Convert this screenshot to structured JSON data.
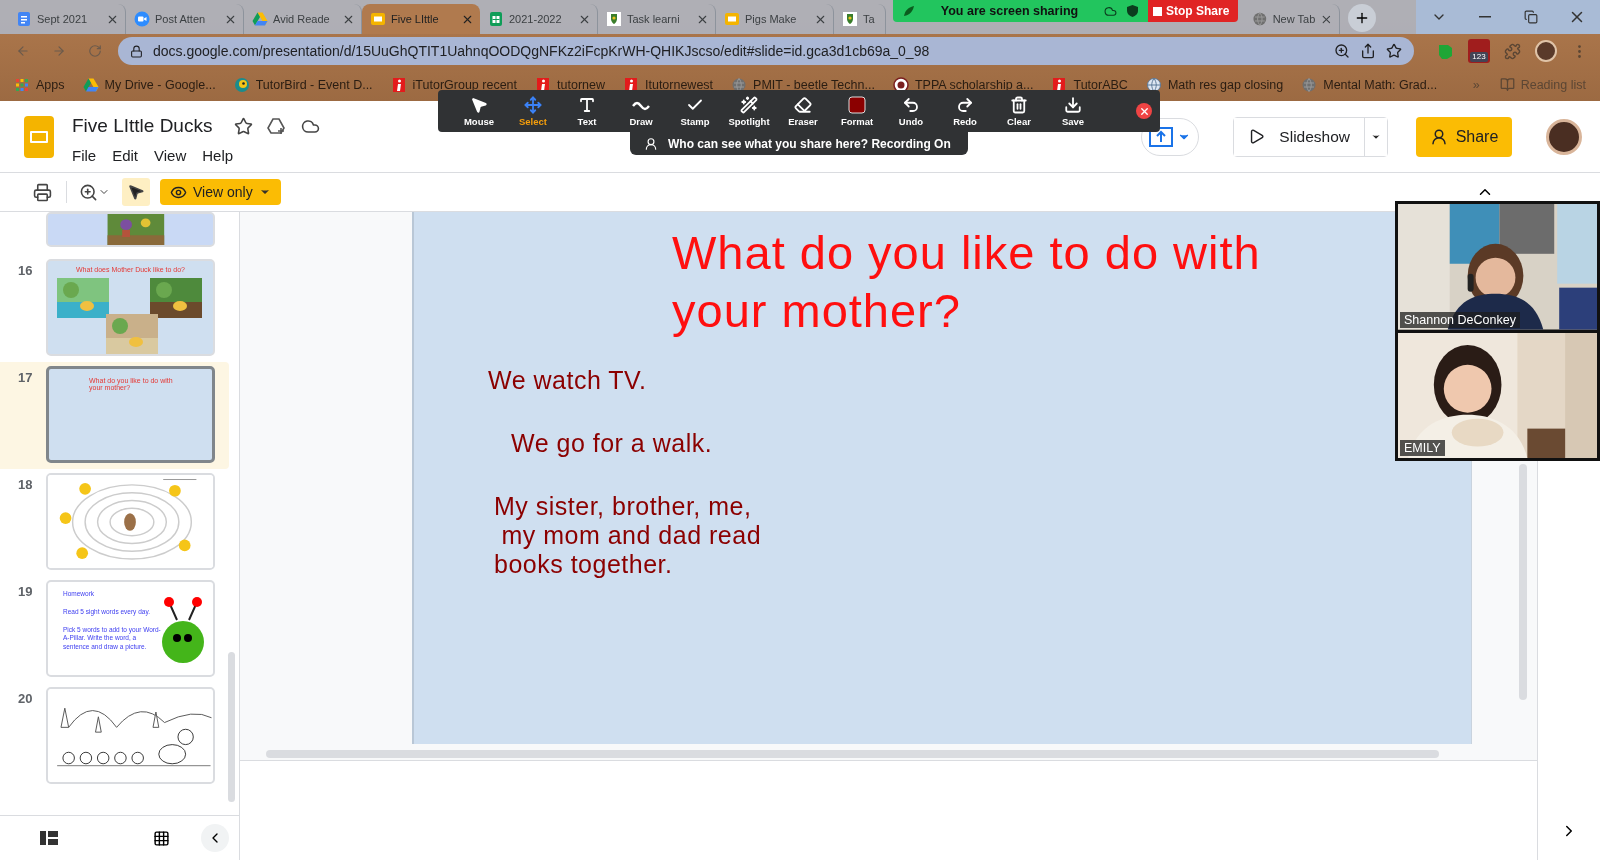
{
  "browser": {
    "tabs": [
      {
        "title": "Sept 2021",
        "kind": "docs",
        "selected": false
      },
      {
        "title": "Post Atten",
        "kind": "zoom",
        "selected": false
      },
      {
        "title": "Avid Reade",
        "kind": "drive",
        "selected": false
      },
      {
        "title": "Five LIttle",
        "kind": "slides",
        "selected": true
      },
      {
        "title": "2021-2022",
        "kind": "sheets",
        "selected": false
      },
      {
        "title": "Task learni",
        "selected": false
      },
      {
        "title": "Pigs Make",
        "kind": "slides",
        "selected": false
      },
      {
        "title": "Ta",
        "selected": false
      },
      {
        "title": "New Tab",
        "kind": "globe",
        "selected": false
      }
    ],
    "url": "docs.google.com/presentation/d/15UuGhQTIT1UahnqOODQgNFKz2iFcpKrWH-QHIKJscso/edit#slide=id.gca3d1cb69a_0_98",
    "extension_badge": "123",
    "bookmarks": [
      {
        "label": "Apps",
        "kind": "apps"
      },
      {
        "label": "My Drive - Google...",
        "kind": "drive"
      },
      {
        "label": "TutorBird - Event D...",
        "kind": "bird"
      },
      {
        "label": "iTutorGroup recent",
        "kind": "itutor"
      },
      {
        "label": "tutornew",
        "kind": "itutor"
      },
      {
        "label": "Itutornewest",
        "kind": "itutor"
      },
      {
        "label": "PMIT - beetle Techn...",
        "kind": "globe"
      },
      {
        "label": "TPPA scholarship a...",
        "kind": "crest"
      },
      {
        "label": "TutorABC",
        "kind": "itutor"
      },
      {
        "label": "Math res gap closing",
        "kind": "web"
      },
      {
        "label": "Mental Math: Grad...",
        "kind": "globe"
      }
    ],
    "more": "»",
    "reading_list": "Reading list"
  },
  "share_banner": {
    "status": "You are screen sharing",
    "stop": "Stop Share"
  },
  "annotation_toolbar": {
    "tools": [
      {
        "label": "Mouse",
        "kind": "mouse",
        "selected": false
      },
      {
        "label": "Select",
        "kind": "select",
        "selected": true
      },
      {
        "label": "Text",
        "kind": "text",
        "selected": false
      },
      {
        "label": "Draw",
        "kind": "draw",
        "selected": false
      },
      {
        "label": "Stamp",
        "kind": "stamp",
        "selected": false
      },
      {
        "label": "Spotlight",
        "kind": "spotlight",
        "selected": false
      },
      {
        "label": "Eraser",
        "kind": "eraser",
        "selected": false
      },
      {
        "label": "Format",
        "kind": "format",
        "selected": false
      },
      {
        "label": "Undo",
        "kind": "undo",
        "selected": false
      },
      {
        "label": "Redo",
        "kind": "redo",
        "selected": false
      },
      {
        "label": "Clear",
        "kind": "clear",
        "selected": false
      },
      {
        "label": "Save",
        "kind": "save",
        "selected": false
      }
    ],
    "notice": "Who can see what you share here? Recording On"
  },
  "app": {
    "title": "Five LIttle Ducks",
    "menu": [
      "File",
      "Edit",
      "View",
      "Help"
    ],
    "slideshow": "Slideshow",
    "share": "Share",
    "view_mode": "View only"
  },
  "filmstrip": [
    {
      "kind": "partial",
      "selected": false
    },
    {
      "number": "16",
      "kind": "photos",
      "title": "What does Mother Duck like to do?",
      "selected": false
    },
    {
      "number": "17",
      "kind": "text",
      "title": "What do you like to do with your mother?",
      "selected": true
    },
    {
      "number": "18",
      "kind": "maze",
      "selected": false
    },
    {
      "number": "19",
      "kind": "homework",
      "title": "Homework",
      "lines": [
        "Read 5 sight words every day.",
        "Pick 5 words to add to your Word-A-Pillar. Write the word, a sentence and draw a picture."
      ],
      "selected": false
    },
    {
      "number": "20",
      "kind": "coloring",
      "selected": false
    }
  ],
  "slide": {
    "title_lines": [
      "What do you like to do with",
      "your mother?"
    ],
    "answers": [
      {
        "lines": [
          "We watch TV."
        ]
      },
      {
        "lines": [
          "We go for a walk."
        ]
      },
      {
        "lines": [
          "My sister, brother, me,",
          " my mom and dad read",
          "books together."
        ]
      }
    ]
  },
  "videos": [
    {
      "name": "Shannon DeConkey",
      "kind": "adult"
    },
    {
      "name": "EMILY",
      "kind": "child"
    }
  ]
}
